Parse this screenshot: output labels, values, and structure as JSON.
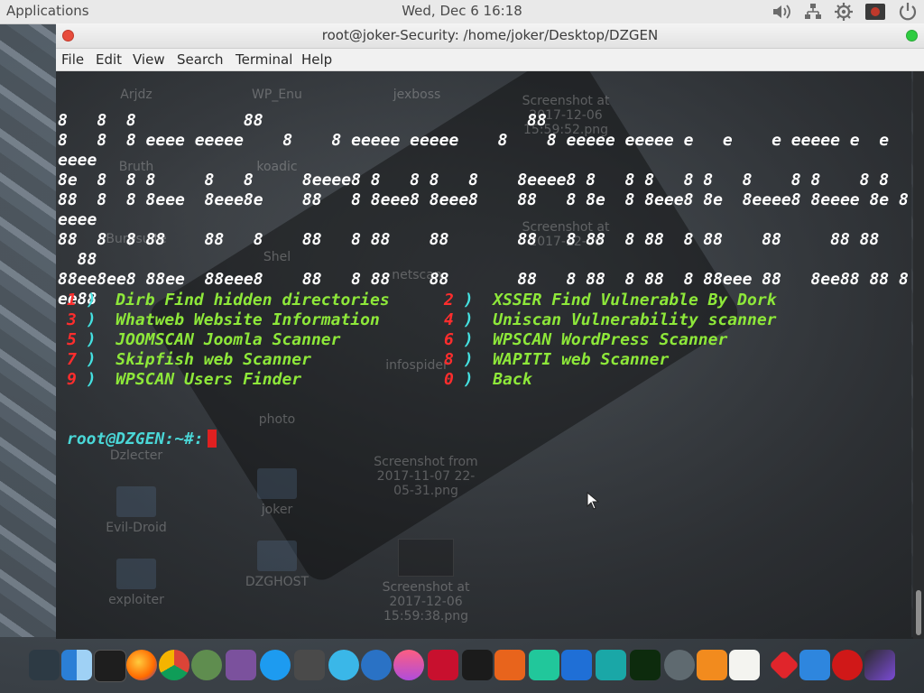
{
  "top_panel": {
    "applications_label": "Applications",
    "clock": "Wed, Dec  6  16:18",
    "tray_icons": [
      "volume-icon",
      "network-icon",
      "settings-gear-icon",
      "recorder-icon",
      "power-icon"
    ]
  },
  "window": {
    "title": "root@joker-Security: /home/joker/Desktop/DZGEN",
    "menu": [
      "File",
      "Edit",
      "View",
      "Search",
      "Terminal",
      "Help"
    ]
  },
  "terminal": {
    "banner_lines": [
      "8   8  8           88                           88",
      "8   8  8 eeee eeeee    8    8 eeeee eeeee    8    8 eeeee eeeee e   e    e eeeee e  e",
      "eeee",
      "8e  8  8 8     8   8     8eeee8 8   8 8   8    8eeee8 8   8 8   8 8   8    8 8    8 8",
      "88  8  8 8eee  8eee8e    88   8 8eee8 8eee8    88   8 8e  8 8eee8 8e  8eeee8 8eeee 8e 8",
      "eeee",
      "88  8  8 88    88   8    88   8 88    88       88   8 88  8 88  8 88    88     88 88",
      "  88",
      "88ee8ee8 88ee  88eee8    88   8 88    88       88   8 88  8 88  8 88eee 88   8ee88 88 8",
      "ee88"
    ],
    "options": [
      {
        "num": "1",
        "label": "Dirb Find hidden directories"
      },
      {
        "num": "2",
        "label": "XSSER Find Vulnerable By Dork"
      },
      {
        "num": "3",
        "label": "Whatweb Website Information"
      },
      {
        "num": "4",
        "label": "Uniscan Vulnerability scanner"
      },
      {
        "num": "5",
        "label": "JOOMSCAN Joomla Scanner"
      },
      {
        "num": "6",
        "label": "WPSCAN WordPress Scanner"
      },
      {
        "num": "7",
        "label": "Skipfish web Scanner"
      },
      {
        "num": "8",
        "label": "WAPITI web Scanner"
      },
      {
        "num": "9",
        "label": "WPSCAN Users Finder"
      },
      {
        "num": "0",
        "label": "Back"
      }
    ],
    "paren": ")",
    "prompt": "root@DZGEN:~#:"
  },
  "desktop_icons": [
    "Arjdz",
    "WP_Enu",
    "jexboss",
    "Screenshot at 2017-12-06 15:59:52.png",
    "Bruth",
    "koadic",
    "Burpsuite",
    "Screenshot at 2017-12-06",
    "netscan",
    "Shel",
    "infospider",
    "photo",
    "Dzlecter",
    "Screenshot from 2017-11-07 22-05-31.png",
    "joker",
    "Evil-Droid",
    "exploiter",
    "DZGHOST",
    "Screenshot at 2017-12-06 15:59:38.png"
  ],
  "dock_apps": [
    "screen-capture-icon",
    "finder-icon",
    "terminal-icon",
    "firefox-icon",
    "chrome-icon",
    "globe-icon",
    "viber-icon",
    "app-store-icon",
    "script-editor-icon",
    "atom-icon",
    "browser-icon",
    "itunes-icon",
    "filezilla-icon",
    "bull-icon",
    "mask-icon",
    "thunder-icon",
    "malwarebytes-icon",
    "avatar-app-icon",
    "matrix-icon",
    "colors-icon",
    "sublime-icon",
    "notes-icon",
    "diamond-icon",
    "windows-apps-icon",
    "record-icon",
    "final-cut-icon"
  ],
  "colors": {
    "option_number": "#ff2d2d",
    "option_paren": "#44e0e0",
    "option_label": "#8ee83a",
    "prompt": "#4ad7d7",
    "cursor": "#e02020"
  }
}
